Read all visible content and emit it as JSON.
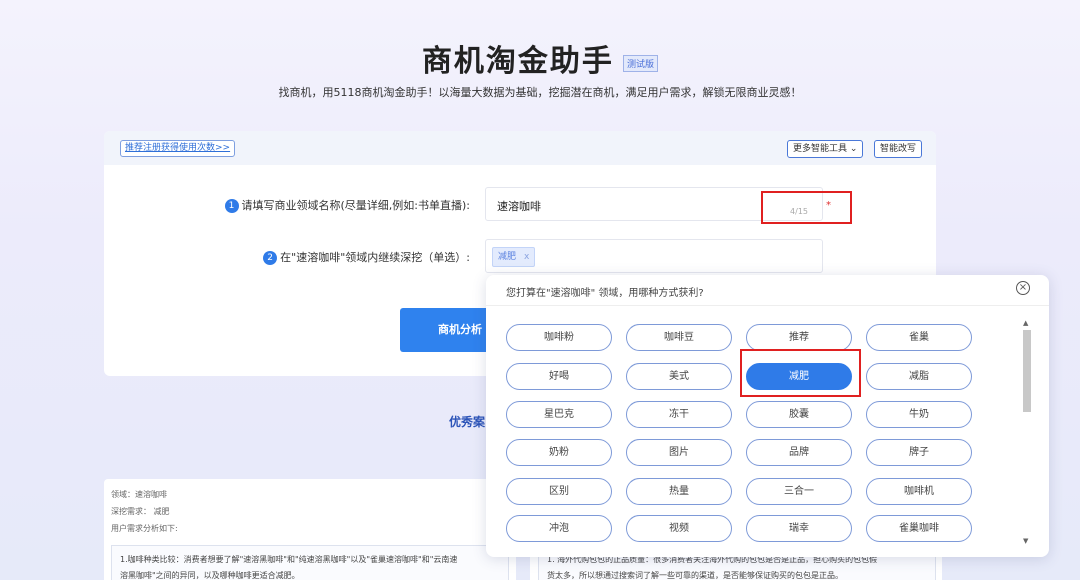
{
  "header": {
    "title": "商机淘金助手",
    "beta_badge": "测试版",
    "subtitle": "找商机，用5118商机淘金助手！以海量大数据为基础，挖掘潜在商机，满足用户需求，解锁无限商业灵感！"
  },
  "toolbar": {
    "register_link": "推荐注册获得使用次数>>",
    "more_tools": "更多智能工具",
    "smart_rewrite": "智能改写"
  },
  "form": {
    "step1_num": "1",
    "step1_label": "请填写商业领域名称(尽量详细,例如:书单直播):",
    "field_value": "速溶咖啡",
    "char_count": "4/15",
    "required_mark": "*",
    "step2_num": "2",
    "step2_label": "在\"速溶咖啡\"领域内继续深挖（单选）:",
    "selected_tag": "减肥",
    "tag_remove": "x",
    "analyze_button": "商机分析"
  },
  "cases": {
    "title": "优秀案",
    "left": {
      "domain": "领域：速溶咖啡",
      "dig": "深挖需求： 减肥",
      "analysis": "用户需求分析如下:",
      "line1": "1.咖啡种类比较：消费者想要了解\"速溶黑咖啡\"和\"纯速溶黑咖啡\"以及\"雀巢速溶咖啡\"和\"云南速",
      "line2": "溶黑咖啡\"之间的异同，以及哪种咖啡更适合减肥。"
    },
    "right": {
      "line1": "1. 海外代购包包的正品质量：很多消费者关注海外代购的包包是否是正品，担心购买的包包假",
      "line2": "货太多，所以想通过搜索词了解一些可靠的渠道，是否能够保证购买的包包是正品。"
    }
  },
  "popup": {
    "question": "您打算在\"速溶咖啡\" 领域，用哪种方式获利?",
    "close_glyph": "×",
    "options": [
      [
        "咖啡粉",
        "咖啡豆",
        "推荐",
        "雀巢"
      ],
      [
        "好喝",
        "美式",
        "减肥",
        "减脂"
      ],
      [
        "星巴克",
        "冻干",
        "胶囊",
        "牛奶"
      ],
      [
        "奶粉",
        "图片",
        "品牌",
        "牌子"
      ],
      [
        "区别",
        "热量",
        "三合一",
        "咖啡机"
      ],
      [
        "冲泡",
        "视频",
        "瑞幸",
        "雀巢咖啡"
      ]
    ],
    "selected_option": "减肥"
  },
  "colors": {
    "accent": "#2f7be8",
    "highlight_box": "#e02020"
  }
}
